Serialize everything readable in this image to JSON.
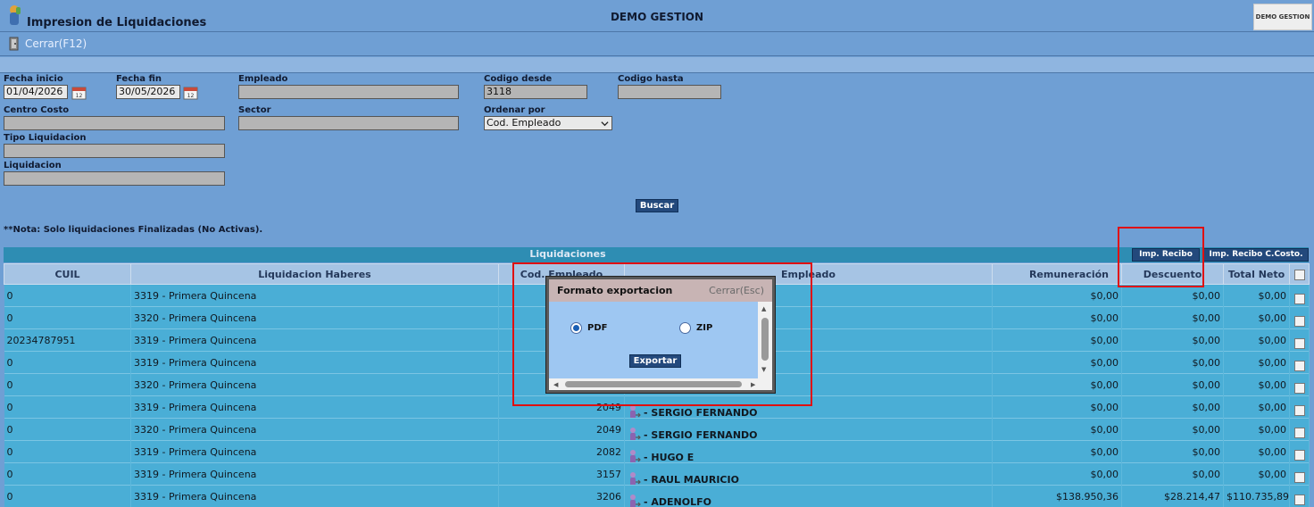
{
  "window": {
    "title": "Impresion de Liquidaciones",
    "company": "DEMO GESTION",
    "company_logo_text": "DEMO GESTION"
  },
  "toolbar": {
    "close_label": "Cerrar(F12)"
  },
  "filters": {
    "fecha_inicio": {
      "label": "Fecha inicio",
      "value": "01/04/2026"
    },
    "fecha_fin": {
      "label": "Fecha fin",
      "value": "30/05/2026"
    },
    "empleado": {
      "label": "Empleado",
      "value": ""
    },
    "codigo_desde": {
      "label": "Codigo desde",
      "value": "3118"
    },
    "codigo_hasta": {
      "label": "Codigo hasta",
      "value": ""
    },
    "centro_costo": {
      "label": "Centro Costo",
      "value": ""
    },
    "sector": {
      "label": "Sector",
      "value": ""
    },
    "ordenar_por": {
      "label": "Ordenar por",
      "value": "Cod. Empleado"
    },
    "tipo_liquidacion": {
      "label": "Tipo Liquidacion",
      "value": ""
    },
    "liquidacion": {
      "label": "Liquidacion",
      "value": ""
    },
    "search_label": "Buscar",
    "note": "**Nota: Solo liquidaciones Finalizadas (No Activas)."
  },
  "section": {
    "title": "Liquidaciones",
    "imp_recibo_label": "Imp. Recibo",
    "imp_recibo_ccosto_label": "Imp. Recibo C.Costo."
  },
  "table": {
    "columns": [
      "CUIL",
      "Liquidacion Haberes",
      "Cod. Empleado",
      "Empleado",
      "Remuneración",
      "Descuento",
      "Total Neto"
    ],
    "rows": [
      {
        "cuil": "0",
        "liquidacion": "3319 - Primera Quincena",
        "cod": "",
        "empleado": "",
        "remuneracion": "$0,00",
        "descuento": "$0,00",
        "neto": "$0,00"
      },
      {
        "cuil": "0",
        "liquidacion": "3320 - Primera Quincena",
        "cod": "",
        "empleado": "",
        "remuneracion": "$0,00",
        "descuento": "$0,00",
        "neto": "$0,00"
      },
      {
        "cuil": "20234787951",
        "liquidacion": "3319 - Primera Quincena",
        "cod": "",
        "empleado": "",
        "remuneracion": "$0,00",
        "descuento": "$0,00",
        "neto": "$0,00"
      },
      {
        "cuil": "0",
        "liquidacion": "3319 - Primera Quincena",
        "cod": "",
        "empleado": "",
        "remuneracion": "$0,00",
        "descuento": "$0,00",
        "neto": "$0,00"
      },
      {
        "cuil": "0",
        "liquidacion": "3320 - Primera Quincena",
        "cod": "",
        "empleado": "",
        "remuneracion": "$0,00",
        "descuento": "$0,00",
        "neto": "$0,00"
      },
      {
        "cuil": "0",
        "liquidacion": "3319 - Primera Quincena",
        "cod": "2049",
        "empleado": "- SERGIO FERNANDO",
        "remuneracion": "$0,00",
        "descuento": "$0,00",
        "neto": "$0,00"
      },
      {
        "cuil": "0",
        "liquidacion": "3320 - Primera Quincena",
        "cod": "2049",
        "empleado": "- SERGIO FERNANDO",
        "remuneracion": "$0,00",
        "descuento": "$0,00",
        "neto": "$0,00"
      },
      {
        "cuil": "0",
        "liquidacion": "3319 - Primera Quincena",
        "cod": "2082",
        "empleado": "- HUGO E",
        "remuneracion": "$0,00",
        "descuento": "$0,00",
        "neto": "$0,00"
      },
      {
        "cuil": "0",
        "liquidacion": "3319 - Primera Quincena",
        "cod": "3157",
        "empleado": "- RAUL MAURICIO",
        "remuneracion": "$0,00",
        "descuento": "$0,00",
        "neto": "$0,00"
      },
      {
        "cuil": "0",
        "liquidacion": "3319 - Primera Quincena",
        "cod": "3206",
        "empleado": "- ADENOLFO",
        "remuneracion": "$138.950,36",
        "descuento": "$28.214,47",
        "neto": "$110.735,89"
      }
    ]
  },
  "modal": {
    "title": "Formato exportacion",
    "close_label": "Cerrar(Esc)",
    "options": [
      {
        "label": "PDF",
        "selected": true
      },
      {
        "label": "ZIP",
        "selected": false
      }
    ],
    "export_label": "Exportar"
  },
  "colors": {
    "background": "#6f9fd4",
    "table_row": "#4aaed6",
    "button": "#23497c",
    "highlight": "#e01010"
  }
}
